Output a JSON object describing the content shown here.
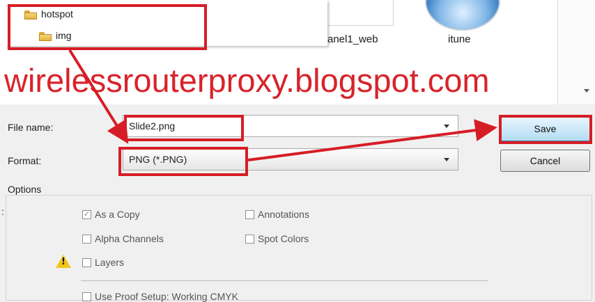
{
  "browser": {
    "tree_items": [
      "hotspot",
      "img"
    ],
    "files": [
      {
        "label": "anel1_web",
        "icon": "image-thumbnail-icon"
      },
      {
        "label": "itune",
        "icon": "disc-icon"
      }
    ]
  },
  "watermark": "wirelessrouterproxy.blogspot.com",
  "form": {
    "file_name_label": "File name:",
    "file_name_value": "Slide2.png",
    "format_label": "Format:",
    "format_value": "PNG (*.PNG)"
  },
  "buttons": {
    "save": "Save",
    "cancel": "Cancel"
  },
  "options": {
    "title": "Options",
    "as_a_copy": "As a Copy",
    "annotations": "Annotations",
    "alpha_channels": "Alpha Channels",
    "spot_colors": "Spot Colors",
    "layers": "Layers",
    "use_proof_setup": "Use Proof Setup:  Working CMYK"
  },
  "colors": {
    "annotation_red": "#d61d26",
    "save_blue": "#b4dcf4",
    "warning_yellow": "#f3c41a"
  }
}
